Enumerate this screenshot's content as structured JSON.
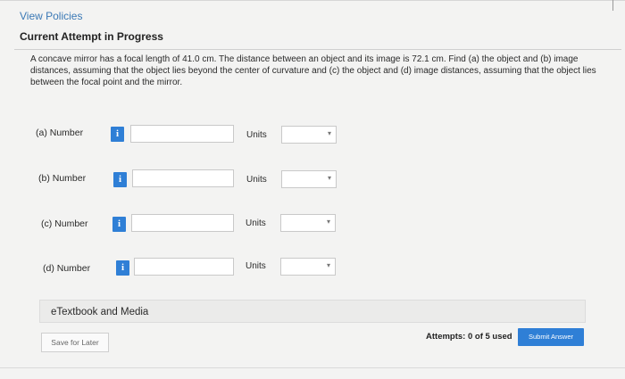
{
  "header": {
    "view_policies": "View Policies",
    "current_attempt": "Current Attempt in Progress"
  },
  "question": {
    "text": "A concave mirror has a focal length of 41.0 cm. The distance between an object and its image is 72.1 cm. Find (a) the object and (b) image distances, assuming that the object lies beyond the center of curvature and (c) the object and (d) image distances, assuming that the object lies between the focal point and the mirror."
  },
  "answers": [
    {
      "label": "(a)  Number",
      "info": "i",
      "value": "",
      "units_label": "Units",
      "units_value": ""
    },
    {
      "label": "(b)  Number",
      "info": "i",
      "value": "",
      "units_label": "Units",
      "units_value": ""
    },
    {
      "label": "(c)  Number",
      "info": "i",
      "value": "",
      "units_label": "Units",
      "units_value": ""
    },
    {
      "label": "(d)  Number",
      "info": "i",
      "value": "",
      "units_label": "Units",
      "units_value": ""
    }
  ],
  "resources": {
    "etextbook": "eTextbook and Media"
  },
  "footer": {
    "save_later": "Save for Later",
    "attempts": "Attempts: 0 of 5 used",
    "submit": "Submit Answer"
  },
  "colors": {
    "accent": "#2f7fd6",
    "link": "#3a78b5",
    "background": "#f3f3f2"
  }
}
